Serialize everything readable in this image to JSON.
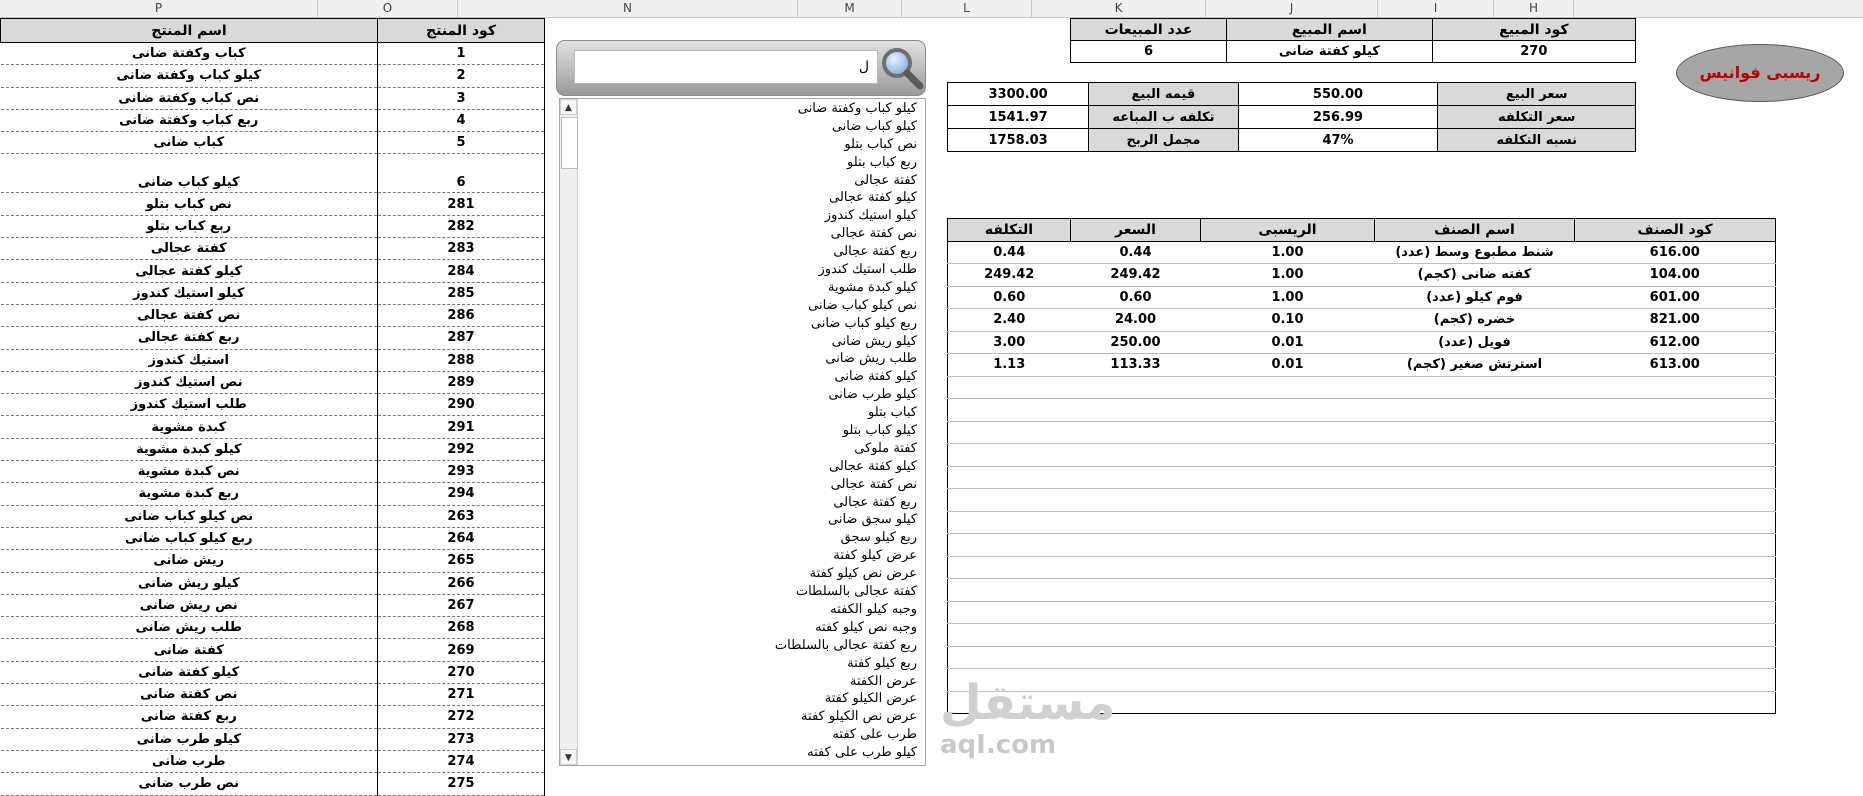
{
  "columns": [
    "P",
    "O",
    "N",
    "M",
    "L",
    "K",
    "J",
    "I",
    "H"
  ],
  "products": {
    "headers": {
      "name": "اسم المنتج",
      "code": "كود المنتج"
    },
    "rows": [
      {
        "name": "كباب وكفتة ضانى",
        "code": "1"
      },
      {
        "name": "كيلو كباب وكفتة ضانى",
        "code": "2"
      },
      {
        "name": "نص كباب وكفتة ضانى",
        "code": "3"
      },
      {
        "name": "ربع كباب وكفتة ضانى",
        "code": "4"
      },
      {
        "name": "كباب ضانى",
        "code": "5"
      },
      {
        "name": "كيلو كباب ضانى",
        "code": "6"
      },
      {
        "name": "نص كباب بتلو",
        "code": "281"
      },
      {
        "name": "ربع كباب بتلو",
        "code": "282"
      },
      {
        "name": "كفتة عجالى",
        "code": "283"
      },
      {
        "name": "كيلو كفتة عجالى",
        "code": "284"
      },
      {
        "name": "كيلو استيك كندوز",
        "code": "285"
      },
      {
        "name": "نص كفتة عجالى",
        "code": "286"
      },
      {
        "name": "ربع كفتة عجالى",
        "code": "287"
      },
      {
        "name": "استيك كندوز",
        "code": "288"
      },
      {
        "name": "نص استيك كندوز",
        "code": "289"
      },
      {
        "name": "طلب استيك كندوز",
        "code": "290"
      },
      {
        "name": "كبدة مشوية",
        "code": "291"
      },
      {
        "name": "كيلو كبدة مشوية",
        "code": "292"
      },
      {
        "name": "نص كبدة مشوية",
        "code": "293"
      },
      {
        "name": "ربع كبدة مشوية",
        "code": "294"
      },
      {
        "name": "نص كيلو كباب ضانى",
        "code": "263"
      },
      {
        "name": "ربع كيلو كباب ضانى",
        "code": "264"
      },
      {
        "name": "ريش ضانى",
        "code": "265"
      },
      {
        "name": "كيلو ريش ضانى",
        "code": "266"
      },
      {
        "name": "نص ريش ضانى",
        "code": "267"
      },
      {
        "name": "طلب ريش ضانى",
        "code": "268"
      },
      {
        "name": "كفتة ضانى",
        "code": "269"
      },
      {
        "name": "كيلو كفتة ضانى",
        "code": "270"
      },
      {
        "name": "نص كفتة ضانى",
        "code": "271"
      },
      {
        "name": "ربع كفتة ضانى",
        "code": "272"
      },
      {
        "name": "كيلو طرب ضانى",
        "code": "273"
      },
      {
        "name": "طرب ضانى",
        "code": "274"
      },
      {
        "name": "نص طرب ضانى",
        "code": "275"
      }
    ]
  },
  "search": {
    "value": "ل"
  },
  "listbox": {
    "items": [
      "كيلو كباب وكفتة ضانى",
      "كيلو كباب ضانى",
      "نص كباب بتلو",
      "ربع كباب بتلو",
      "كفتة عجالى",
      "كيلو كفتة عجالى",
      "كيلو استيك كندوز",
      "نص كفتة عجالى",
      "ربع كفتة عجالى",
      "طلب استيك كندوز",
      "كيلو كبدة مشوية",
      "نص كيلو كباب ضانى",
      "ربع كيلو كباب ضانى",
      "كيلو ريش ضانى",
      "طلب ريش ضانى",
      "كيلو كفتة ضانى",
      "كيلو طرب ضانى",
      "كباب بتلو",
      "كيلو كباب بتلو",
      "كفتة ملوكى",
      "كيلو كفتة عجالى",
      "نص كفتة عجالى",
      "ربع كفتة عجالى",
      "كيلو سجق ضانى",
      "ربع كيلو سجق",
      "عرض كيلو كفتة",
      "عرض نص كيلو كفتة",
      "كفتة عجالى بالسلطات",
      "وجبه كيلو الكفته",
      "وجبه نص كيلو كفته",
      "ربع كفتة عجالى بالسلطات",
      "ربع كيلو كفتة",
      "عرض الكفتة",
      "عرض الكيلو كفتة",
      "عرض نص الكيلو كفتة",
      "طرب على كفته",
      "كيلو طرب على كفته"
    ]
  },
  "sale": {
    "headers": {
      "qty": "عدد المبيعات",
      "name": "اسم المبيع",
      "code": "كود المبيع"
    },
    "qty": "6",
    "name": "كيلو كفتة ضانى",
    "code": "270"
  },
  "pricing": [
    {
      "value": "3300.00",
      "label": "قيمه البيع",
      "value2": "550.00",
      "label2": "سعر البيع"
    },
    {
      "value": "1541.97",
      "label": "تكلفه ب المباعه",
      "value2": "256.99",
      "label2": "سعر التكلفه"
    },
    {
      "value": "1758.03",
      "label": "مجمل الربح",
      "value2": "47%",
      "label2": "نسبه التكلفه"
    }
  ],
  "recipe_button": {
    "label": "ريسبى فوانيس"
  },
  "items": {
    "headers": {
      "cost": "التكلفه",
      "price": "السعر",
      "recipe": "الريسبى",
      "name": "اسم الصنف",
      "code": "كود الصنف"
    },
    "rows": [
      {
        "cost": "0.44",
        "price": "0.44",
        "recipe": "1.00",
        "name": "شنط مطبوع وسط (عدد)",
        "code": "616.00"
      },
      {
        "cost": "249.42",
        "price": "249.42",
        "recipe": "1.00",
        "name": "كفته ضانى (كجم)",
        "code": "104.00"
      },
      {
        "cost": "0.60",
        "price": "0.60",
        "recipe": "1.00",
        "name": "فوم كيلو (عدد)",
        "code": "601.00"
      },
      {
        "cost": "2.40",
        "price": "24.00",
        "recipe": "0.10",
        "name": "خضره (كجم)",
        "code": "821.00"
      },
      {
        "cost": "3.00",
        "price": "250.00",
        "recipe": "0.01",
        "name": "فويل (عدد)",
        "code": "612.00"
      },
      {
        "cost": "1.13",
        "price": "113.33",
        "recipe": "0.01",
        "name": "استرتش صغير (كجم)",
        "code": "613.00"
      }
    ]
  },
  "watermark": {
    "text1": "مستقل",
    "text2": "aqI.com"
  }
}
